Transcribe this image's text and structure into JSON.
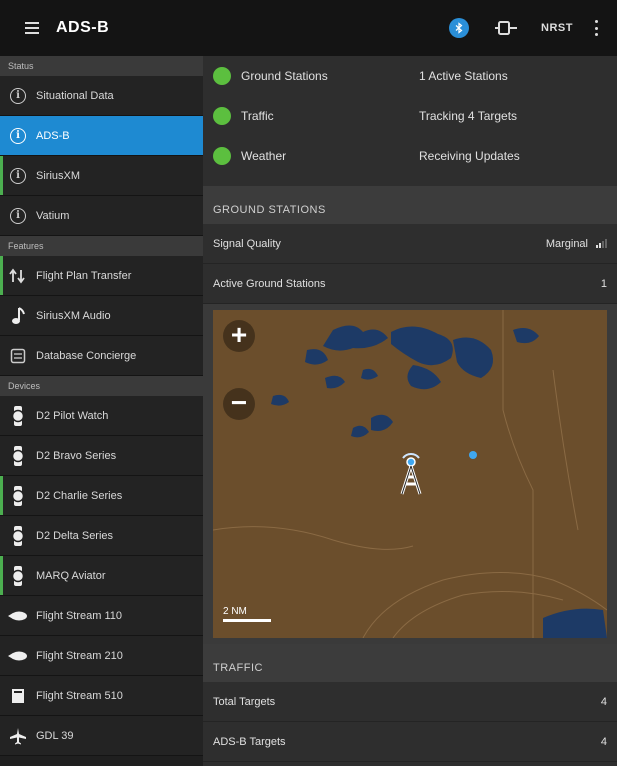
{
  "appbar": {
    "title": "ADS-B",
    "nrst_label": "NRST",
    "icons": [
      "menu-icon",
      "bluetooth-icon",
      "device-connection-icon",
      "more-vert-icon"
    ]
  },
  "sidebar": {
    "status_header": "Status",
    "status_items": [
      {
        "label": "Situational Data",
        "icon": "info-icon"
      },
      {
        "label": "ADS-B",
        "icon": "info-icon",
        "active": true
      },
      {
        "label": "SiriusXM",
        "icon": "info-icon"
      },
      {
        "label": "Vatium",
        "icon": "info-icon"
      }
    ],
    "features_header": "Features",
    "feature_items": [
      {
        "label": "Flight Plan Transfer",
        "icon": "transfer-icon"
      },
      {
        "label": "SiriusXM Audio",
        "icon": "music-note-icon"
      },
      {
        "label": "Database Concierge",
        "icon": "database-icon"
      }
    ],
    "devices_header": "Devices",
    "device_items": [
      {
        "label": "D2 Pilot Watch",
        "icon": "watch-icon"
      },
      {
        "label": "D2 Bravo Series",
        "icon": "watch-icon"
      },
      {
        "label": "D2 Charlie Series",
        "icon": "watch-icon"
      },
      {
        "label": "D2 Delta Series",
        "icon": "watch-icon"
      },
      {
        "label": "MARQ Aviator",
        "icon": "watch-icon"
      },
      {
        "label": "Flight Stream 110",
        "icon": "flight-stream-icon"
      },
      {
        "label": "Flight Stream 210",
        "icon": "flight-stream-icon"
      },
      {
        "label": "Flight Stream 510",
        "icon": "sd-card-icon"
      },
      {
        "label": "GDL 39",
        "icon": "plane-icon"
      }
    ]
  },
  "status": [
    {
      "name": "Ground Stations",
      "value": "1 Active Stations"
    },
    {
      "name": "Traffic",
      "value": "Tracking 4 Targets"
    },
    {
      "name": "Weather",
      "value": "Receiving Updates"
    }
  ],
  "ground_stations": {
    "header": "GROUND STATIONS",
    "signal_label": "Signal Quality",
    "signal_value": "Marginal",
    "active_label": "Active Ground Stations",
    "active_value": "1"
  },
  "map": {
    "zoom_in": "+",
    "zoom_out": "−",
    "scale": "2 NM"
  },
  "traffic": {
    "header": "TRAFFIC",
    "total_label": "Total Targets",
    "total_value": "4",
    "adsb_label": "ADS-B Targets",
    "adsb_value": "4"
  },
  "colors": {
    "accent": "#1e8ad2",
    "status_ok": "#5cbf3f",
    "map_land": "#6b4e2c",
    "map_water": "#1d3a66"
  }
}
